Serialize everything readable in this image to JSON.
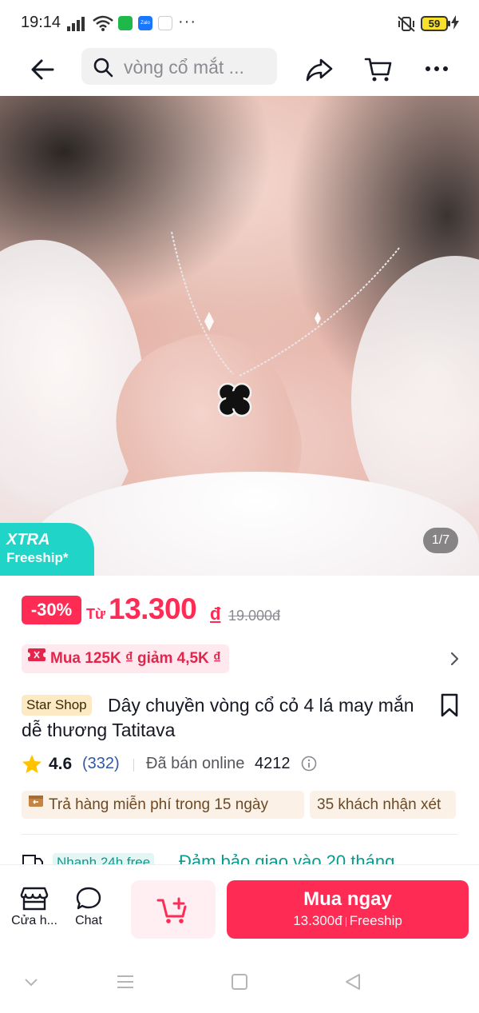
{
  "status_bar": {
    "time": "19:14",
    "more": "···",
    "battery": "59",
    "apps": [
      "app-icon-green",
      "Zalo",
      "app-icon-shop"
    ]
  },
  "top_nav": {
    "search_text": "vòng cổ mắt ..."
  },
  "product_image": {
    "counter": "1/7",
    "badge_line1": "XTRA",
    "badge_line2": "Freeship*"
  },
  "price": {
    "discount": "-30%",
    "from_label": "Từ",
    "current": "13.300",
    "currency": "đ",
    "original": "19.000đ"
  },
  "promo": {
    "text": "Mua 125K ₫ giảm 4,5K ₫"
  },
  "product": {
    "shop_badge": "Star Shop",
    "title": "Dây chuyền vòng cổ cỏ 4 lá may mắn dễ thương Tatitava",
    "rating": "4.6",
    "reviews": "(332)",
    "sold_label": "Đã bán online",
    "sold_count": "4212"
  },
  "chips": {
    "returns": "Trả hàng miễn phí trong 15 ngày",
    "reviews": "35 khách nhận xét"
  },
  "shipping": {
    "badge": "Nhanh 24h free",
    "text": "Đảm bảo giao vào 20 tháng"
  },
  "action_bar": {
    "shop_label": "Cửa h...",
    "chat_label": "Chat",
    "buy_label": "Mua ngay",
    "buy_price": "13.300đ",
    "buy_shipping": "Freeship"
  },
  "colors": {
    "accent": "#fe2c55",
    "xtra_badge": "#20d4c7",
    "chip_bg": "#fbf1e6",
    "shipping_teal": "#0a9a8e"
  }
}
